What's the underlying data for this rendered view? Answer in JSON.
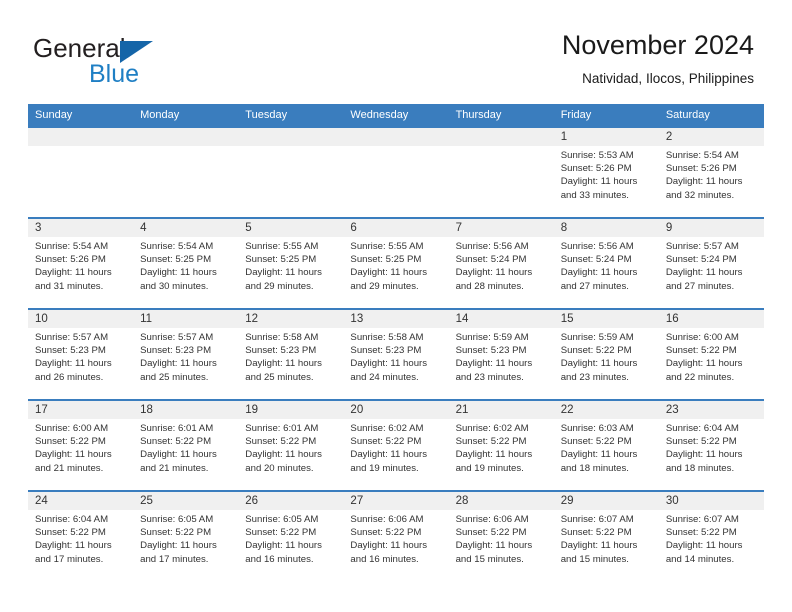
{
  "logo": {
    "word_one": "General",
    "word_two": "Blue",
    "triangle_color": "#1565a8",
    "blue_color": "#1f7fc4"
  },
  "header": {
    "title": "November 2024",
    "subtitle": "Natividad, Ilocos, Philippines"
  },
  "theme": {
    "header_row_bg": "#3a7dbe",
    "cell_strip_bg": "#f0f0f0",
    "cell_top_border": "#3a7dbe",
    "text": "#333333"
  },
  "weekdays": [
    "Sunday",
    "Monday",
    "Tuesday",
    "Wednesday",
    "Thursday",
    "Friday",
    "Saturday"
  ],
  "weeks": [
    [
      {
        "day": "",
        "empty": true,
        "sunrise": "",
        "sunset": "",
        "daylight_1": "",
        "daylight_2": ""
      },
      {
        "day": "",
        "empty": true,
        "sunrise": "",
        "sunset": "",
        "daylight_1": "",
        "daylight_2": ""
      },
      {
        "day": "",
        "empty": true,
        "sunrise": "",
        "sunset": "",
        "daylight_1": "",
        "daylight_2": ""
      },
      {
        "day": "",
        "empty": true,
        "sunrise": "",
        "sunset": "",
        "daylight_1": "",
        "daylight_2": ""
      },
      {
        "day": "",
        "empty": true,
        "sunrise": "",
        "sunset": "",
        "daylight_1": "",
        "daylight_2": ""
      },
      {
        "day": "1",
        "empty": false,
        "sunrise": "Sunrise: 5:53 AM",
        "sunset": "Sunset: 5:26 PM",
        "daylight_1": "Daylight: 11 hours",
        "daylight_2": "and 33 minutes."
      },
      {
        "day": "2",
        "empty": false,
        "sunrise": "Sunrise: 5:54 AM",
        "sunset": "Sunset: 5:26 PM",
        "daylight_1": "Daylight: 11 hours",
        "daylight_2": "and 32 minutes."
      }
    ],
    [
      {
        "day": "3",
        "empty": false,
        "sunrise": "Sunrise: 5:54 AM",
        "sunset": "Sunset: 5:26 PM",
        "daylight_1": "Daylight: 11 hours",
        "daylight_2": "and 31 minutes."
      },
      {
        "day": "4",
        "empty": false,
        "sunrise": "Sunrise: 5:54 AM",
        "sunset": "Sunset: 5:25 PM",
        "daylight_1": "Daylight: 11 hours",
        "daylight_2": "and 30 minutes."
      },
      {
        "day": "5",
        "empty": false,
        "sunrise": "Sunrise: 5:55 AM",
        "sunset": "Sunset: 5:25 PM",
        "daylight_1": "Daylight: 11 hours",
        "daylight_2": "and 29 minutes."
      },
      {
        "day": "6",
        "empty": false,
        "sunrise": "Sunrise: 5:55 AM",
        "sunset": "Sunset: 5:25 PM",
        "daylight_1": "Daylight: 11 hours",
        "daylight_2": "and 29 minutes."
      },
      {
        "day": "7",
        "empty": false,
        "sunrise": "Sunrise: 5:56 AM",
        "sunset": "Sunset: 5:24 PM",
        "daylight_1": "Daylight: 11 hours",
        "daylight_2": "and 28 minutes."
      },
      {
        "day": "8",
        "empty": false,
        "sunrise": "Sunrise: 5:56 AM",
        "sunset": "Sunset: 5:24 PM",
        "daylight_1": "Daylight: 11 hours",
        "daylight_2": "and 27 minutes."
      },
      {
        "day": "9",
        "empty": false,
        "sunrise": "Sunrise: 5:57 AM",
        "sunset": "Sunset: 5:24 PM",
        "daylight_1": "Daylight: 11 hours",
        "daylight_2": "and 27 minutes."
      }
    ],
    [
      {
        "day": "10",
        "empty": false,
        "sunrise": "Sunrise: 5:57 AM",
        "sunset": "Sunset: 5:23 PM",
        "daylight_1": "Daylight: 11 hours",
        "daylight_2": "and 26 minutes."
      },
      {
        "day": "11",
        "empty": false,
        "sunrise": "Sunrise: 5:57 AM",
        "sunset": "Sunset: 5:23 PM",
        "daylight_1": "Daylight: 11 hours",
        "daylight_2": "and 25 minutes."
      },
      {
        "day": "12",
        "empty": false,
        "sunrise": "Sunrise: 5:58 AM",
        "sunset": "Sunset: 5:23 PM",
        "daylight_1": "Daylight: 11 hours",
        "daylight_2": "and 25 minutes."
      },
      {
        "day": "13",
        "empty": false,
        "sunrise": "Sunrise: 5:58 AM",
        "sunset": "Sunset: 5:23 PM",
        "daylight_1": "Daylight: 11 hours",
        "daylight_2": "and 24 minutes."
      },
      {
        "day": "14",
        "empty": false,
        "sunrise": "Sunrise: 5:59 AM",
        "sunset": "Sunset: 5:23 PM",
        "daylight_1": "Daylight: 11 hours",
        "daylight_2": "and 23 minutes."
      },
      {
        "day": "15",
        "empty": false,
        "sunrise": "Sunrise: 5:59 AM",
        "sunset": "Sunset: 5:22 PM",
        "daylight_1": "Daylight: 11 hours",
        "daylight_2": "and 23 minutes."
      },
      {
        "day": "16",
        "empty": false,
        "sunrise": "Sunrise: 6:00 AM",
        "sunset": "Sunset: 5:22 PM",
        "daylight_1": "Daylight: 11 hours",
        "daylight_2": "and 22 minutes."
      }
    ],
    [
      {
        "day": "17",
        "empty": false,
        "sunrise": "Sunrise: 6:00 AM",
        "sunset": "Sunset: 5:22 PM",
        "daylight_1": "Daylight: 11 hours",
        "daylight_2": "and 21 minutes."
      },
      {
        "day": "18",
        "empty": false,
        "sunrise": "Sunrise: 6:01 AM",
        "sunset": "Sunset: 5:22 PM",
        "daylight_1": "Daylight: 11 hours",
        "daylight_2": "and 21 minutes."
      },
      {
        "day": "19",
        "empty": false,
        "sunrise": "Sunrise: 6:01 AM",
        "sunset": "Sunset: 5:22 PM",
        "daylight_1": "Daylight: 11 hours",
        "daylight_2": "and 20 minutes."
      },
      {
        "day": "20",
        "empty": false,
        "sunrise": "Sunrise: 6:02 AM",
        "sunset": "Sunset: 5:22 PM",
        "daylight_1": "Daylight: 11 hours",
        "daylight_2": "and 19 minutes."
      },
      {
        "day": "21",
        "empty": false,
        "sunrise": "Sunrise: 6:02 AM",
        "sunset": "Sunset: 5:22 PM",
        "daylight_1": "Daylight: 11 hours",
        "daylight_2": "and 19 minutes."
      },
      {
        "day": "22",
        "empty": false,
        "sunrise": "Sunrise: 6:03 AM",
        "sunset": "Sunset: 5:22 PM",
        "daylight_1": "Daylight: 11 hours",
        "daylight_2": "and 18 minutes."
      },
      {
        "day": "23",
        "empty": false,
        "sunrise": "Sunrise: 6:04 AM",
        "sunset": "Sunset: 5:22 PM",
        "daylight_1": "Daylight: 11 hours",
        "daylight_2": "and 18 minutes."
      }
    ],
    [
      {
        "day": "24",
        "empty": false,
        "sunrise": "Sunrise: 6:04 AM",
        "sunset": "Sunset: 5:22 PM",
        "daylight_1": "Daylight: 11 hours",
        "daylight_2": "and 17 minutes."
      },
      {
        "day": "25",
        "empty": false,
        "sunrise": "Sunrise: 6:05 AM",
        "sunset": "Sunset: 5:22 PM",
        "daylight_1": "Daylight: 11 hours",
        "daylight_2": "and 17 minutes."
      },
      {
        "day": "26",
        "empty": false,
        "sunrise": "Sunrise: 6:05 AM",
        "sunset": "Sunset: 5:22 PM",
        "daylight_1": "Daylight: 11 hours",
        "daylight_2": "and 16 minutes."
      },
      {
        "day": "27",
        "empty": false,
        "sunrise": "Sunrise: 6:06 AM",
        "sunset": "Sunset: 5:22 PM",
        "daylight_1": "Daylight: 11 hours",
        "daylight_2": "and 16 minutes."
      },
      {
        "day": "28",
        "empty": false,
        "sunrise": "Sunrise: 6:06 AM",
        "sunset": "Sunset: 5:22 PM",
        "daylight_1": "Daylight: 11 hours",
        "daylight_2": "and 15 minutes."
      },
      {
        "day": "29",
        "empty": false,
        "sunrise": "Sunrise: 6:07 AM",
        "sunset": "Sunset: 5:22 PM",
        "daylight_1": "Daylight: 11 hours",
        "daylight_2": "and 15 minutes."
      },
      {
        "day": "30",
        "empty": false,
        "sunrise": "Sunrise: 6:07 AM",
        "sunset": "Sunset: 5:22 PM",
        "daylight_1": "Daylight: 11 hours",
        "daylight_2": "and 14 minutes."
      }
    ]
  ]
}
